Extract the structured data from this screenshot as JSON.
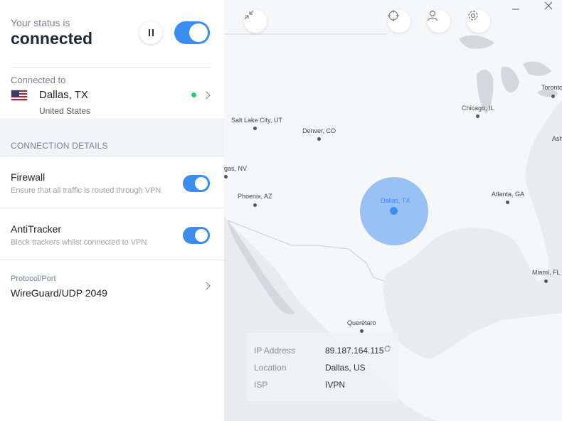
{
  "status": {
    "label": "Your status is",
    "value": "connected"
  },
  "connection": {
    "label": "Connected to",
    "city": "Dallas, TX",
    "country": "United States"
  },
  "details": {
    "section_title": "CONNECTION DETAILS",
    "firewall": {
      "title": "Firewall",
      "desc": "Ensure that all traffic is routed through VPN",
      "on": true
    },
    "antitracker": {
      "title": "AntiTracker",
      "desc": "Block trackers whilst connected to VPN",
      "on": true
    },
    "protocol": {
      "label": "Protocol/Port",
      "value": "WireGuard/UDP 2049"
    }
  },
  "map": {
    "cities": [
      {
        "name": "Salt Lake City, UT"
      },
      {
        "name": "Denver, CO"
      },
      {
        "name": "gas, NV"
      },
      {
        "name": "Phoenix, AZ"
      },
      {
        "name": "Chicago, IL"
      },
      {
        "name": "Toronto"
      },
      {
        "name": "Ash"
      },
      {
        "name": "Atlanta, GA"
      },
      {
        "name": "Miami, FL"
      },
      {
        "name": "Querétaro"
      }
    ],
    "current_location": "Dallas, TX"
  },
  "info": {
    "ip_label": "IP Address",
    "ip_value": "89.187.164.115",
    "location_label": "Location",
    "location_value": "Dallas, US",
    "isp_label": "ISP",
    "isp_value": "IVPN"
  },
  "colors": {
    "accent": "#3b8ef0",
    "connected_dot": "#2dcf6c",
    "map_land": "#f6f7f8",
    "map_water": "#cfd4d9"
  },
  "icons": {
    "pause": "pause-icon",
    "collapse": "collapse-icon",
    "target": "crosshair-icon",
    "account": "user-icon",
    "settings": "gear-icon",
    "refresh": "refresh-icon"
  }
}
